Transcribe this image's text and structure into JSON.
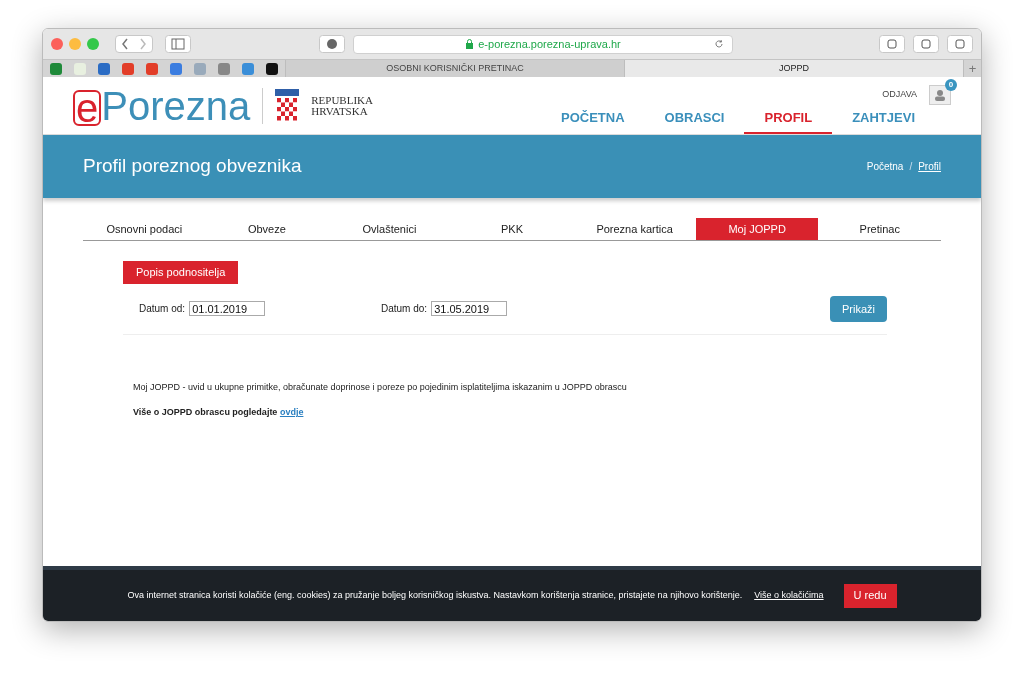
{
  "browser": {
    "url": "e-porezna.porezna-uprava.hr",
    "tabs": [
      {
        "label": "OSOBNI KORISNIČKI PRETINAC",
        "selected": false
      },
      {
        "label": "JOPPD",
        "selected": true
      }
    ],
    "new_tab": "+"
  },
  "header": {
    "logo": {
      "mark": "e",
      "name": "Porezna"
    },
    "emblem_text": [
      "REPUBLIKA",
      "HRVATSKA"
    ],
    "logout": "ODJAVA",
    "badge": "0",
    "nav": [
      {
        "label": "POČETNA",
        "selected": false
      },
      {
        "label": "OBRASCI",
        "selected": false
      },
      {
        "label": "PROFIL",
        "selected": true
      },
      {
        "label": "ZAHTJEVI",
        "selected": false
      }
    ]
  },
  "banner": {
    "title": "Profil poreznog obveznika",
    "breadcrumb": [
      {
        "label": "Početna",
        "current": false
      },
      {
        "label": "Profil",
        "current": true
      }
    ],
    "separator": "/"
  },
  "tabs": [
    {
      "label": "Osnovni podaci",
      "selected": false
    },
    {
      "label": "Obveze",
      "selected": false
    },
    {
      "label": "Ovlaštenici",
      "selected": false
    },
    {
      "label": "PKK",
      "selected": false
    },
    {
      "label": "Porezna kartica",
      "selected": false
    },
    {
      "label": "Moj JOPPD",
      "selected": true
    },
    {
      "label": "Pretinac",
      "selected": false
    }
  ],
  "list_button": "Popis podnositelja",
  "filters": [
    {
      "label": "Datum od:",
      "value": "01.01.2019"
    },
    {
      "label": "Datum do:",
      "value": "31.05.2019"
    }
  ],
  "show_button": "Prikaži",
  "description": "Moj JOPPD - uvid u ukupne primitke, obračunate doprinose i poreze po pojedinim isplatiteljima iskazanim u JOPPD obrascu",
  "more": {
    "text": "Više o JOPPD obrascu pogledajte",
    "link": "ovdje"
  },
  "cookie_bar": {
    "text": "Ova internet stranica koristi kolačiće (eng. cookies) za pružanje boljeg korisničkog iskustva. Nastavkom korištenja stranice, pristajete na njihovo korištenje.",
    "link": "Više o kolačićima",
    "button": "U redu"
  }
}
